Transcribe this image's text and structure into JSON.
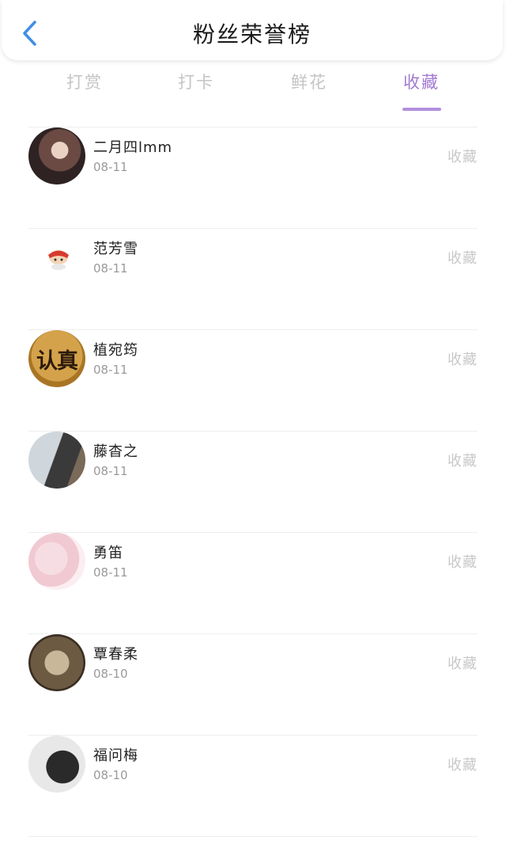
{
  "header": {
    "title": "粉丝荣誉榜",
    "back_icon": "chevron-left-icon",
    "accent_color": "#3f8ee6"
  },
  "tabs": [
    {
      "label": "打赏",
      "active": false
    },
    {
      "label": "打卡",
      "active": false
    },
    {
      "label": "鲜花",
      "active": false
    },
    {
      "label": "收藏",
      "active": true
    }
  ],
  "active_tab_color": "#a27ad2",
  "fans": [
    {
      "name": "二月四lmm",
      "date": "08-11",
      "action": "收藏"
    },
    {
      "name": "范芳雪",
      "date": "08-11",
      "action": "收藏"
    },
    {
      "name": "植宛筠",
      "date": "08-11",
      "action": "收藏",
      "avatar_text": "认真"
    },
    {
      "name": "藤杳之",
      "date": "08-11",
      "action": "收藏"
    },
    {
      "name": "勇笛",
      "date": "08-11",
      "action": "收藏"
    },
    {
      "name": "覃春柔",
      "date": "08-10",
      "action": "收藏"
    },
    {
      "name": "福问梅",
      "date": "08-10",
      "action": "收藏"
    }
  ]
}
